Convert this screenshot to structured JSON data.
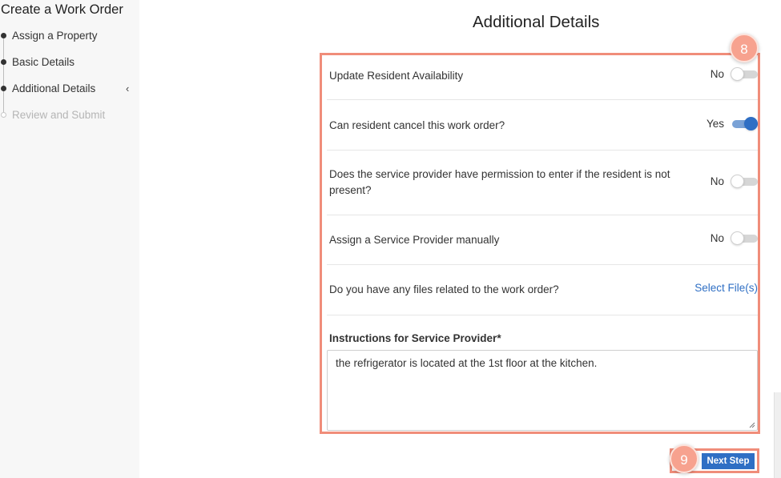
{
  "sidebar": {
    "title": "Create a Work Order",
    "steps": [
      {
        "label": "Assign a Property"
      },
      {
        "label": "Basic Details"
      },
      {
        "label": "Additional Details"
      },
      {
        "label": "Review and Submit"
      }
    ]
  },
  "main": {
    "title": "Additional Details",
    "rows": [
      {
        "label": "Update Resident Availability",
        "value": "No"
      },
      {
        "label": "Can resident cancel this work order?",
        "value": "Yes"
      },
      {
        "label": "Does the service provider have permission to enter if the resident is not present?",
        "value": "No"
      },
      {
        "label": "Assign a Service Provider manually",
        "value": "No"
      },
      {
        "label": "Do you have any files related to the work order?",
        "action": "Select File(s)"
      }
    ],
    "instructions": {
      "label": "Instructions for Service Provider*",
      "value": "the refrigerator is located at the 1st floor at the kitchen."
    },
    "next_button": "Next Step"
  },
  "annotations": {
    "badge_8": "8",
    "badge_9": "9"
  },
  "colors": {
    "accent": "#2f6fc4",
    "highlight": "#f08d7a",
    "badge": "#f7a28f"
  }
}
